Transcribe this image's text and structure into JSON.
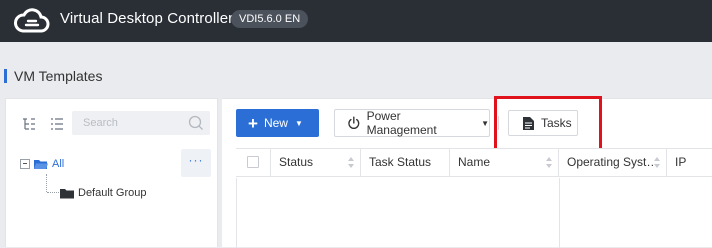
{
  "header": {
    "app_title": "Virtual Desktop Controller",
    "version": "VDI5.6.0 EN",
    "logo_icon": "cloud-logo-icon"
  },
  "page": {
    "title": "VM Templates"
  },
  "sidebar": {
    "search_placeholder": "Search",
    "more_label": "···",
    "tree": {
      "root_label": "All",
      "children": [
        {
          "label": "Default Group"
        }
      ]
    }
  },
  "toolbar": {
    "new_label": "New",
    "power_label": "Power Management",
    "tasks_label": "Tasks"
  },
  "table": {
    "columns": [
      "Status",
      "Task Status",
      "Name",
      "Operating Syst…",
      "IP"
    ]
  },
  "colors": {
    "accent": "#2b6fd6",
    "header_bg": "#2a2f36",
    "highlight": "#e0121b"
  }
}
